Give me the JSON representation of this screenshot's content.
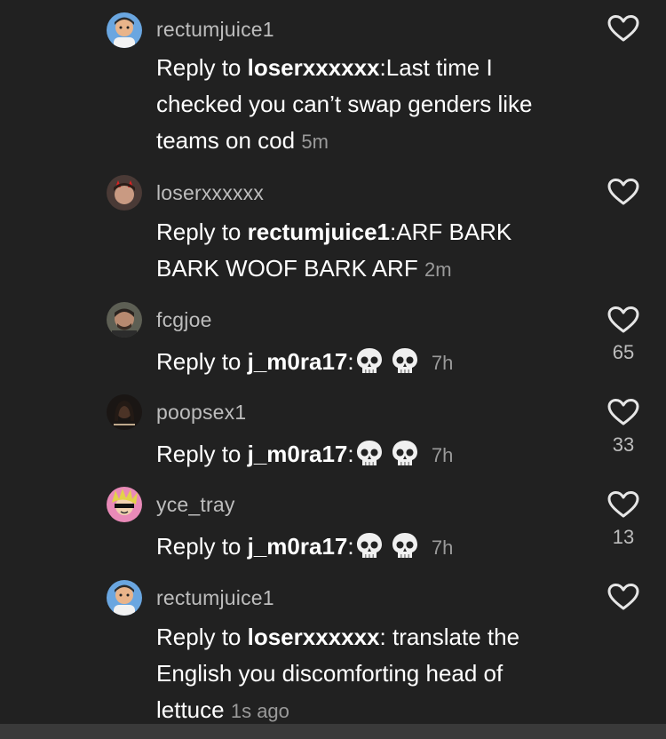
{
  "comments": [
    {
      "username": "rectumjuice1",
      "reply_prefix": "Reply to ",
      "reply_to": "loserxxxxxx",
      "separator": ":",
      "text": "Last time I checked you can’t swap genders like teams on cod",
      "time": "5m",
      "likes": "",
      "avatar_icon": "cartoon-avatar-icon"
    },
    {
      "username": "loserxxxxxx",
      "reply_prefix": "Reply to ",
      "reply_to": "rectumjuice1",
      "separator": ":",
      "text": "ARF BARK BARK WOOF BARK ARF",
      "time": "2m",
      "likes": "",
      "avatar_icon": "devil-horns-avatar-icon"
    },
    {
      "username": "fcgjoe",
      "reply_prefix": "Reply to ",
      "reply_to": "j_m0ra17",
      "separator": ":",
      "emoji": "💀💀",
      "time": "7h",
      "likes": "65",
      "avatar_icon": "person-photo-avatar-icon"
    },
    {
      "username": "poopsex1",
      "reply_prefix": "Reply to ",
      "reply_to": "j_m0ra17",
      "separator": ":",
      "emoji": "💀💀",
      "time": "7h",
      "likes": "33",
      "avatar_icon": "dark-photo-avatar-icon"
    },
    {
      "username": "yce_tray",
      "reply_prefix": "Reply to ",
      "reply_to": "j_m0ra17",
      "separator": ":",
      "emoji": "💀💀",
      "time": "7h",
      "likes": "13",
      "avatar_icon": "anime-avatar-icon"
    },
    {
      "username": "rectumjuice1",
      "reply_prefix": "Reply to ",
      "reply_to": "loserxxxxxx",
      "separator": ": ",
      "text": "translate the English you discomforting head of lettuce",
      "time": "1s ago",
      "likes": "",
      "avatar_icon": "cartoon-avatar-icon"
    }
  ],
  "colors": {
    "background": "#212121",
    "username": "#bdbdbd",
    "text": "#ffffff",
    "timestamp": "#9a9a9a"
  }
}
